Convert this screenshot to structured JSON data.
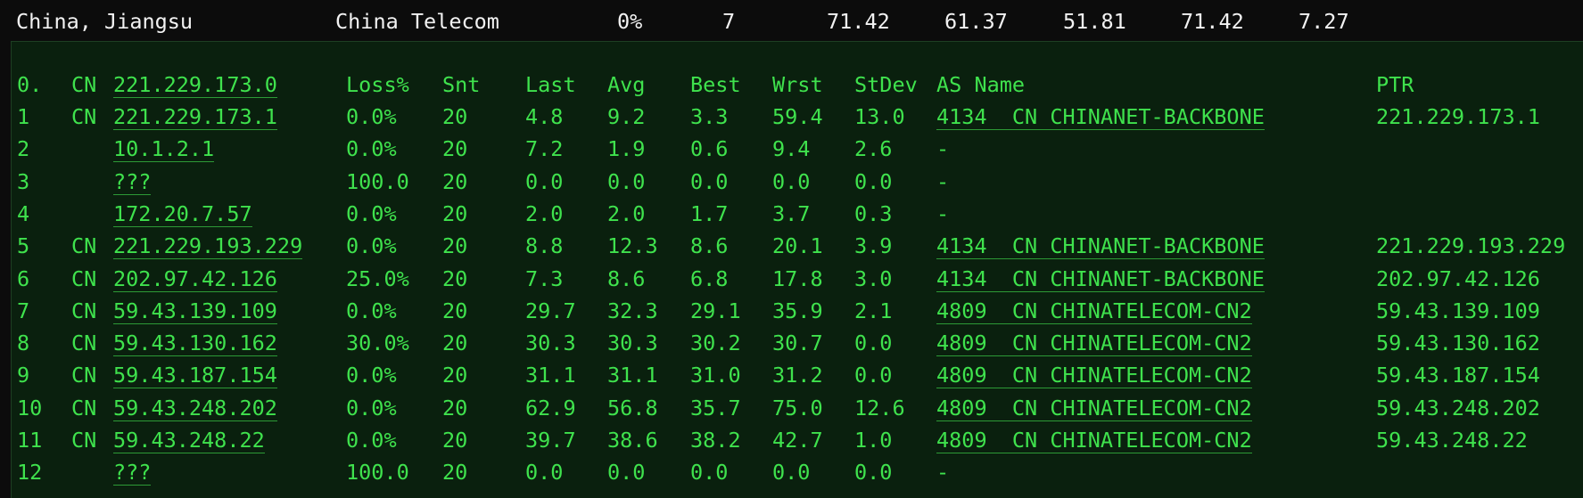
{
  "summary": {
    "location": "China, Jiangsu",
    "isp": "China Telecom",
    "loss": "0%",
    "hops": "7",
    "v1": "71.42",
    "v2": "61.37",
    "v3": "51.81",
    "v4": "71.42",
    "v5": "7.27"
  },
  "header": {
    "idx": "0.",
    "cc": "CN",
    "host": "221.229.173.0",
    "loss": "Loss%",
    "snt": "Snt",
    "last": "Last",
    "avg": "Avg",
    "best": "Best",
    "wrst": "Wrst",
    "stdev": "StDev",
    "as": "AS Name",
    "ptr": "PTR"
  },
  "hops": [
    {
      "idx": "1",
      "cc": "CN",
      "host": "221.229.173.1",
      "loss": "0.0%",
      "snt": "20",
      "last": "4.8",
      "avg": "9.2",
      "best": "3.3",
      "wrst": "59.4",
      "stdev": "13.0",
      "asn": "4134",
      "ascc": "CN",
      "asname": "CHINANET-BACKBONE",
      "ptr": "221.229.173.1"
    },
    {
      "idx": "2",
      "cc": "",
      "host": "10.1.2.1",
      "loss": "0.0%",
      "snt": "20",
      "last": "7.2",
      "avg": "1.9",
      "best": "0.6",
      "wrst": "9.4",
      "stdev": "2.6",
      "asn": "-",
      "ascc": "",
      "asname": "",
      "ptr": ""
    },
    {
      "idx": "3",
      "cc": "",
      "host": "???",
      "loss": "100.0",
      "snt": "20",
      "last": "0.0",
      "avg": "0.0",
      "best": "0.0",
      "wrst": "0.0",
      "stdev": "0.0",
      "asn": "-",
      "ascc": "",
      "asname": "",
      "ptr": ""
    },
    {
      "idx": "4",
      "cc": "",
      "host": "172.20.7.57",
      "loss": "0.0%",
      "snt": "20",
      "last": "2.0",
      "avg": "2.0",
      "best": "1.7",
      "wrst": "3.7",
      "stdev": "0.3",
      "asn": "-",
      "ascc": "",
      "asname": "",
      "ptr": ""
    },
    {
      "idx": "5",
      "cc": "CN",
      "host": "221.229.193.229",
      "loss": "0.0%",
      "snt": "20",
      "last": "8.8",
      "avg": "12.3",
      "best": "8.6",
      "wrst": "20.1",
      "stdev": "3.9",
      "asn": "4134",
      "ascc": "CN",
      "asname": "CHINANET-BACKBONE",
      "ptr": "221.229.193.229"
    },
    {
      "idx": "6",
      "cc": "CN",
      "host": "202.97.42.126",
      "loss": "25.0%",
      "snt": "20",
      "last": "7.3",
      "avg": "8.6",
      "best": "6.8",
      "wrst": "17.8",
      "stdev": "3.0",
      "asn": "4134",
      "ascc": "CN",
      "asname": "CHINANET-BACKBONE",
      "ptr": "202.97.42.126"
    },
    {
      "idx": "7",
      "cc": "CN",
      "host": "59.43.139.109",
      "loss": "0.0%",
      "snt": "20",
      "last": "29.7",
      "avg": "32.3",
      "best": "29.1",
      "wrst": "35.9",
      "stdev": "2.1",
      "asn": "4809",
      "ascc": "CN",
      "asname": "CHINATELECOM-CN2",
      "ptr": "59.43.139.109"
    },
    {
      "idx": "8",
      "cc": "CN",
      "host": "59.43.130.162",
      "loss": "30.0%",
      "snt": "20",
      "last": "30.3",
      "avg": "30.3",
      "best": "30.2",
      "wrst": "30.7",
      "stdev": "0.0",
      "asn": "4809",
      "ascc": "CN",
      "asname": "CHINATELECOM-CN2",
      "ptr": "59.43.130.162"
    },
    {
      "idx": "9",
      "cc": "CN",
      "host": "59.43.187.154",
      "loss": "0.0%",
      "snt": "20",
      "last": "31.1",
      "avg": "31.1",
      "best": "31.0",
      "wrst": "31.2",
      "stdev": "0.0",
      "asn": "4809",
      "ascc": "CN",
      "asname": "CHINATELECOM-CN2",
      "ptr": "59.43.187.154"
    },
    {
      "idx": "10",
      "cc": "CN",
      "host": "59.43.248.202",
      "loss": "0.0%",
      "snt": "20",
      "last": "62.9",
      "avg": "56.8",
      "best": "35.7",
      "wrst": "75.0",
      "stdev": "12.6",
      "asn": "4809",
      "ascc": "CN",
      "asname": "CHINATELECOM-CN2",
      "ptr": "59.43.248.202"
    },
    {
      "idx": "11",
      "cc": "CN",
      "host": "59.43.248.22",
      "loss": "0.0%",
      "snt": "20",
      "last": "39.7",
      "avg": "38.6",
      "best": "38.2",
      "wrst": "42.7",
      "stdev": "1.0",
      "asn": "4809",
      "ascc": "CN",
      "asname": "CHINATELECOM-CN2",
      "ptr": "59.43.248.22"
    },
    {
      "idx": "12",
      "cc": "",
      "host": "???",
      "loss": "100.0",
      "snt": "20",
      "last": "0.0",
      "avg": "0.0",
      "best": "0.0",
      "wrst": "0.0",
      "stdev": "0.0",
      "asn": "-",
      "ascc": "",
      "asname": "",
      "ptr": ""
    }
  ],
  "colors": {
    "text_green": "#3fe24d",
    "summary_text": "#f2f2f2",
    "panel_bg": "#0a200e",
    "page_bg": "#0c0c0c"
  }
}
